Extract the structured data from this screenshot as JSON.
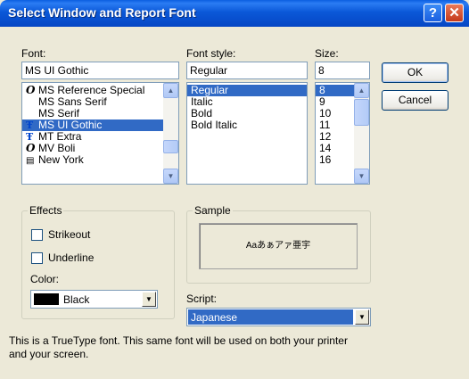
{
  "window": {
    "title": "Select Window and Report Font",
    "help_label": "?",
    "close_label": "✕"
  },
  "font": {
    "label": "Font:",
    "value": "MS UI Gothic",
    "items": [
      {
        "label": "MS Reference Special",
        "icon": "opentype-icon",
        "glyph": "O",
        "selected": false
      },
      {
        "label": "MS Sans Serif",
        "icon": "none",
        "glyph": "",
        "selected": false
      },
      {
        "label": "MS Serif",
        "icon": "none",
        "glyph": "",
        "selected": false
      },
      {
        "label": "MS UI Gothic",
        "icon": "truetype-icon",
        "glyph": "Ŧ",
        "selected": true
      },
      {
        "label": "MT Extra",
        "icon": "truetype-icon",
        "glyph": "Ŧ",
        "selected": false
      },
      {
        "label": "MV Boli",
        "icon": "opentype-icon",
        "glyph": "O",
        "selected": false
      },
      {
        "label": "New York",
        "icon": "printer-icon",
        "glyph": "▤",
        "selected": false
      }
    ]
  },
  "style": {
    "label": "Font style:",
    "value": "Regular",
    "items": [
      {
        "label": "Regular",
        "selected": true
      },
      {
        "label": "Italic",
        "selected": false
      },
      {
        "label": "Bold",
        "selected": false
      },
      {
        "label": "Bold Italic",
        "selected": false
      }
    ]
  },
  "size": {
    "label": "Size:",
    "value": "8",
    "items": [
      {
        "label": "8",
        "selected": true
      },
      {
        "label": "9",
        "selected": false
      },
      {
        "label": "10",
        "selected": false
      },
      {
        "label": "11",
        "selected": false
      },
      {
        "label": "12",
        "selected": false
      },
      {
        "label": "14",
        "selected": false
      },
      {
        "label": "16",
        "selected": false
      }
    ]
  },
  "buttons": {
    "ok": "OK",
    "cancel": "Cancel"
  },
  "effects": {
    "label": "Effects",
    "strikeout": "Strikeout",
    "underline": "Underline",
    "color_label": "Color:",
    "color_value": "Black",
    "color_hex": "#000000"
  },
  "sample": {
    "label": "Sample",
    "text": "Aaあぁアァ亜宇"
  },
  "script": {
    "label": "Script:",
    "value": "Japanese"
  },
  "info_text": "This is a TrueType font. This same font will be used on both your printer and your screen."
}
